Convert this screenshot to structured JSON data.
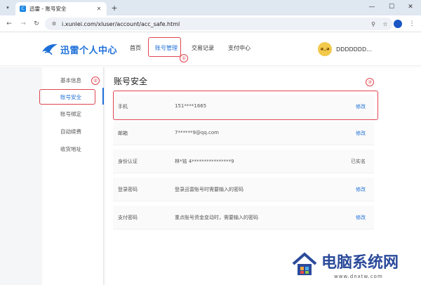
{
  "browser": {
    "tab_title": "迅雷 - 账号安全",
    "url": "i.xunlei.com/xluser/account/acc_safe.html"
  },
  "header": {
    "logo_text": "迅雷个人中心",
    "nav": [
      "首页",
      "账号管理",
      "交易记录",
      "支付中心"
    ],
    "active_nav": "账号管理",
    "user_name": "DDDDDDD..."
  },
  "sidebar": {
    "items": [
      {
        "label": "基本信息"
      },
      {
        "label": "账号安全",
        "active": true
      },
      {
        "label": "账号绑定"
      },
      {
        "label": "自动续费"
      },
      {
        "label": "收货地址"
      }
    ]
  },
  "content": {
    "title": "账号安全",
    "rows": [
      {
        "label": "手机",
        "value": "151****1665",
        "action": "修改"
      },
      {
        "label": "邮箱",
        "value": "7******9@qq.com",
        "action": "修改"
      },
      {
        "label": "身份认证",
        "value": "林*铭 4****************9",
        "status": "已实名"
      },
      {
        "label": "登录密码",
        "value": "登录迅雷账号时需要输入的密码",
        "action": "修改"
      },
      {
        "label": "支付密码",
        "value": "重点账号资金变动时，需要输入的密码",
        "action": "修改"
      }
    ]
  },
  "annotations": [
    "①",
    "②",
    "③"
  ],
  "watermark": {
    "title": "电脑系统网",
    "url": "www.dnxtw.com"
  },
  "colors": {
    "accent": "#1d6fd8",
    "annotation": "#e0454f",
    "watermark": "#2b4a9a"
  }
}
